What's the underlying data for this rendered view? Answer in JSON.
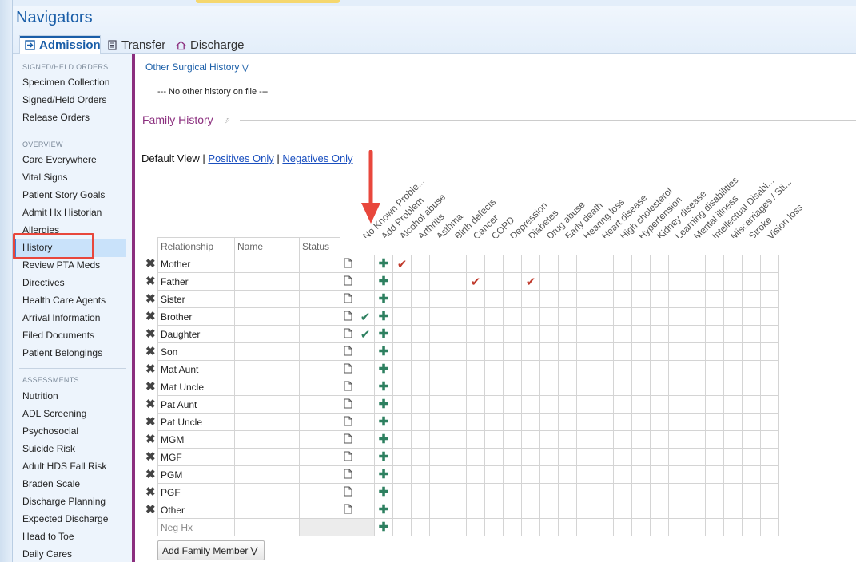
{
  "navigators": {
    "title": "Navigators",
    "tabs": [
      {
        "label": "Admission",
        "icon": "admit-icon"
      },
      {
        "label": "Transfer",
        "icon": "transfer-icon"
      },
      {
        "label": "Discharge",
        "icon": "home-icon"
      }
    ]
  },
  "sidebar": {
    "sections": [
      {
        "label": "SIGNED/HELD ORDERS",
        "items": [
          "Specimen Collection",
          "Signed/Held Orders",
          "Release Orders"
        ]
      },
      {
        "label": "OVERVIEW",
        "items": [
          "Care Everywhere",
          "Vital Signs",
          "Patient Story Goals",
          "Admit Hx Historian",
          "Allergies",
          "History",
          "Review PTA Meds",
          "Directives",
          "Health Care Agents",
          "Arrival Information",
          "Filed Documents",
          "Patient Belongings"
        ]
      },
      {
        "label": "ASSESSMENTS",
        "items": [
          "Nutrition",
          "ADL Screening",
          "Psychosocial",
          "Suicide Risk",
          "Adult HDS Fall Risk",
          "Braden Scale",
          "Discharge Planning",
          "Expected Discharge",
          "Head to Toe",
          "Daily Cares"
        ]
      }
    ],
    "selected": "History"
  },
  "main": {
    "other_surgical_link": "Other Surgical History",
    "no_other_history": "--- No other history on file ---",
    "family_history_title": "Family History",
    "views": {
      "default": "Default View",
      "sep": "|",
      "positives": "Positives Only",
      "negatives": "Negatives Only"
    },
    "table": {
      "headers": {
        "relationship": "Relationship",
        "name": "Name",
        "status": "Status"
      },
      "conditions": [
        "No Known Proble...",
        "Add Problem",
        "Alcohol abuse",
        "Arthritis",
        "Asthma",
        "Birth defects",
        "Cancer",
        "COPD",
        "Depression",
        "Diabetes",
        "Drug abuse",
        "Early death",
        "Hearing loss",
        "Heart disease",
        "High cholesterol",
        "Hypertension",
        "Kidney disease",
        "Learning disabilities",
        "Mental illness",
        "Intellectual Disabi...",
        "Miscarriages / Sti...",
        "Stroke",
        "Vision loss"
      ],
      "rows": [
        {
          "relationship": "Mother",
          "no_known": false,
          "checks": [
            "Alcohol abuse"
          ]
        },
        {
          "relationship": "Father",
          "no_known": false,
          "checks": [
            "Cancer",
            "Diabetes"
          ]
        },
        {
          "relationship": "Sister",
          "no_known": false,
          "checks": []
        },
        {
          "relationship": "Brother",
          "no_known": true,
          "checks": []
        },
        {
          "relationship": "Daughter",
          "no_known": true,
          "checks": []
        },
        {
          "relationship": "Son",
          "no_known": false,
          "checks": []
        },
        {
          "relationship": "Mat Aunt",
          "no_known": false,
          "checks": []
        },
        {
          "relationship": "Mat Uncle",
          "no_known": false,
          "checks": []
        },
        {
          "relationship": "Pat Aunt",
          "no_known": false,
          "checks": []
        },
        {
          "relationship": "Pat Uncle",
          "no_known": false,
          "checks": []
        },
        {
          "relationship": "MGM",
          "no_known": false,
          "checks": []
        },
        {
          "relationship": "MGF",
          "no_known": false,
          "checks": []
        },
        {
          "relationship": "PGM",
          "no_known": false,
          "checks": []
        },
        {
          "relationship": "PGF",
          "no_known": false,
          "checks": []
        },
        {
          "relationship": "Other",
          "no_known": false,
          "checks": []
        }
      ],
      "neg_hx": "Neg Hx"
    },
    "add_family_member": "Add Family Member"
  },
  "colors": {
    "accent": "#1a5ea8",
    "section_purple": "#8b2e7e",
    "annotation_red": "#e8473c",
    "check_green": "#2e8060",
    "check_red": "#c0392b"
  }
}
